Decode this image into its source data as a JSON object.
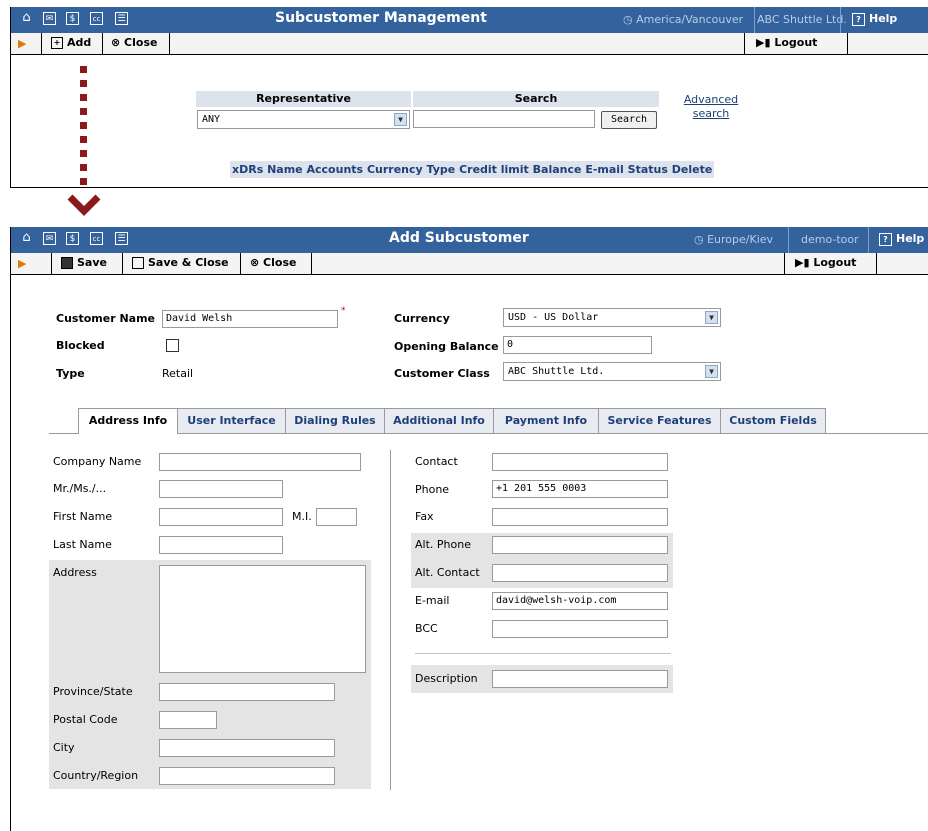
{
  "top_window": {
    "title": "Subcustomer Management",
    "timezone": "America/Vancouver",
    "account": "ABC Shuttle Ltd.",
    "help": "Help",
    "toolbar": {
      "add": "Add",
      "close": "Close",
      "logout": "Logout"
    },
    "search": {
      "representative_header": "Representative",
      "search_header": "Search",
      "representative_value": "ANY",
      "search_value": "",
      "search_button": "Search",
      "advanced_line1": "Advanced",
      "advanced_line2": "search"
    },
    "columns": [
      "xDRs",
      "Name",
      "Accounts",
      "Currency",
      "Type",
      "Credit limit",
      "Balance",
      "E-mail",
      "Status",
      "Delete"
    ]
  },
  "bottom_window": {
    "title": "Add Subcustomer",
    "timezone": "Europe/Kiev",
    "account": "demo-toor",
    "help": "Help",
    "toolbar": {
      "save": "Save",
      "save_close": "Save & Close",
      "close": "Close",
      "logout": "Logout"
    },
    "header_form": {
      "customer_name_label": "Customer Name",
      "customer_name_value": "David Welsh",
      "required_mark": "*",
      "blocked_label": "Blocked",
      "type_label": "Type",
      "type_value": "Retail",
      "currency_label": "Currency",
      "currency_value": "USD - US Dollar",
      "opening_balance_label": "Opening Balance",
      "opening_balance_value": "0",
      "customer_class_label": "Customer Class",
      "customer_class_value": "ABC Shuttle Ltd."
    },
    "tabs": [
      "Address Info",
      "User Interface",
      "Dialing Rules",
      "Additional Info",
      "Payment Info",
      "Service Features",
      "Custom Fields"
    ],
    "address": {
      "company_name": "Company Name",
      "mr_ms": "Mr./Ms./...",
      "first_name": "First Name",
      "mi": "M.I.",
      "last_name": "Last Name",
      "address": "Address",
      "province": "Province/State",
      "postal": "Postal Code",
      "city": "City",
      "country": "Country/Region"
    },
    "contact": {
      "contact": "Contact",
      "phone": "Phone",
      "phone_value": "+1 201 555 0003",
      "fax": "Fax",
      "alt_phone": "Alt. Phone",
      "alt_contact": "Alt. Contact",
      "email": "E-mail",
      "email_value": "david@welsh-voip.com",
      "bcc": "BCC",
      "description": "Description"
    }
  },
  "colors": {
    "title_bar": "#33629c",
    "arrow": "#8b1a1a",
    "tab_text": "#1e3f78"
  }
}
